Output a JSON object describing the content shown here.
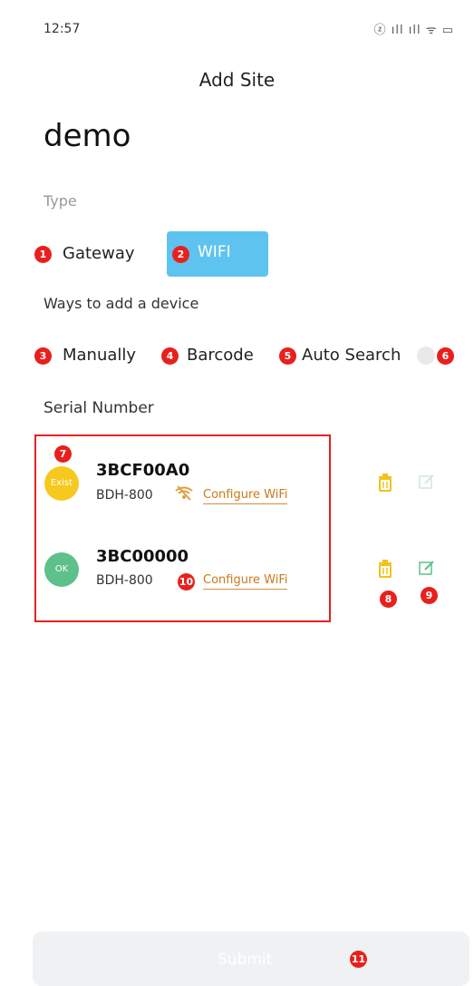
{
  "status_bar": {
    "time": "12:57",
    "icons": "ⓩ ıll ıll ᯤ ▭"
  },
  "header": {
    "title": "Add Site"
  },
  "site": {
    "name": "demo"
  },
  "type_section": {
    "label": "Type",
    "options": [
      {
        "label": "Gateway",
        "badge": "1"
      },
      {
        "label": "WIFI",
        "badge": "2"
      }
    ]
  },
  "ways_section": {
    "label": "Ways to add a device",
    "options": [
      {
        "label": "Manually",
        "badge": "3"
      },
      {
        "label": "Barcode",
        "badge": "4"
      },
      {
        "label": "Auto Search",
        "badge": "5"
      }
    ],
    "info_badge": "6"
  },
  "serial_section": {
    "label": "Serial Number"
  },
  "devices": [
    {
      "status": "Exist",
      "serial": "3BCF00A0",
      "model": "BDH-800",
      "configure": "Configure WiFi",
      "status_color": "#f7c81e"
    },
    {
      "status": "OK",
      "serial": "3BC00000",
      "model": "BDH-800",
      "configure": "Configure WiFi",
      "status_color": "#5ec08a"
    }
  ],
  "badges": {
    "device_list": "7",
    "delete": "8",
    "edit": "9",
    "configure": "10",
    "submit": "11"
  },
  "icons": {
    "delete": "trash-icon",
    "edit": "edit-icon",
    "wifi_off": "wifi-off-icon",
    "info": "info-icon"
  },
  "footer": {
    "submit_label": "Submit"
  }
}
